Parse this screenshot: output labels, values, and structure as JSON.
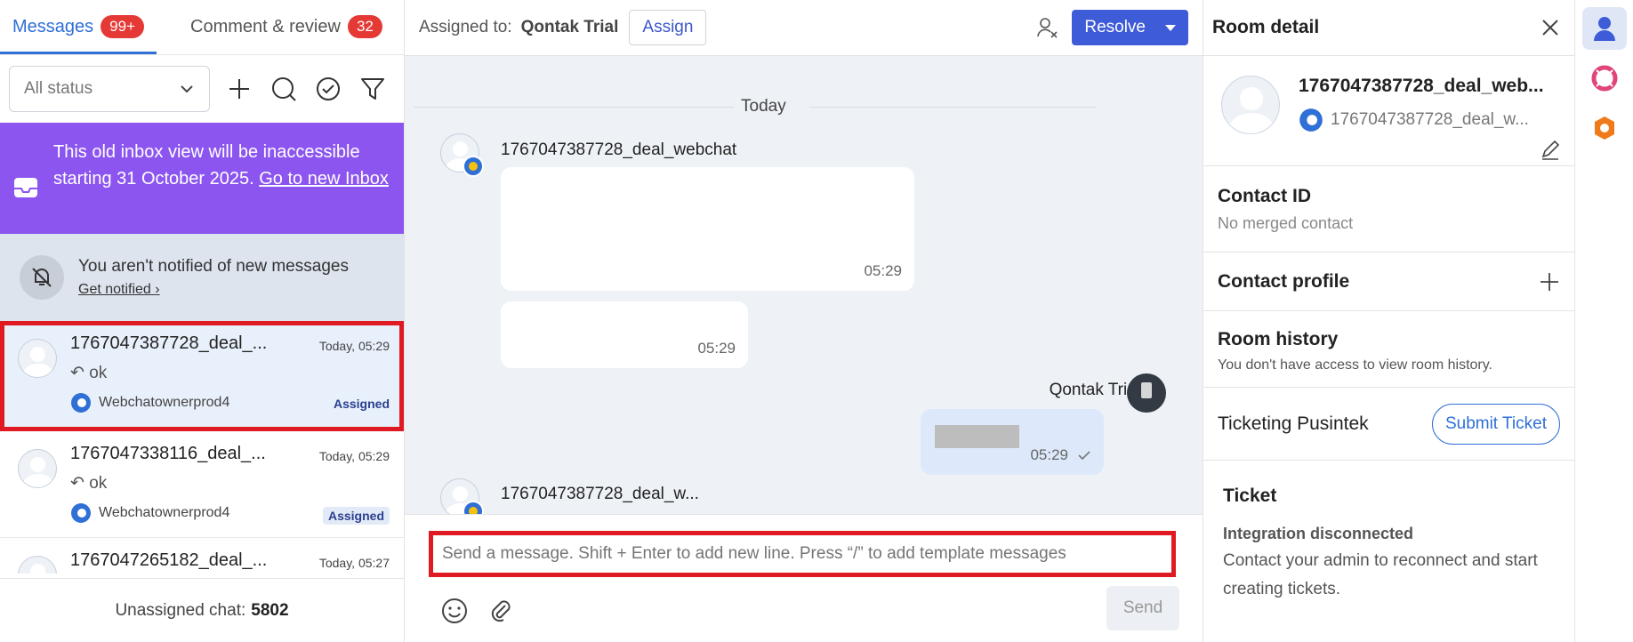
{
  "left": {
    "tabs": [
      {
        "label": "Messages",
        "badge": "99+"
      },
      {
        "label": "Comment & review",
        "badge": "32"
      }
    ],
    "status_filter": "All status",
    "banner": {
      "text": "This old inbox view will be inaccessible starting 31 October 2025. ",
      "link": "Go to new Inbox"
    },
    "notify": {
      "title": "You aren't notified of new messages",
      "link": "Get notified"
    },
    "chats": [
      {
        "name": "1767047387728_deal_...",
        "time": "Today, 05:29",
        "preview": "ok",
        "channel": "Webchatownerprod4",
        "status": "Assigned"
      },
      {
        "name": "1767047338116_deal_...",
        "time": "Today, 05:29",
        "preview": "ok",
        "channel": "Webchatownerprod4",
        "status": "Assigned"
      },
      {
        "name": "1767047265182_deal_...",
        "time": "Today, 05:27"
      }
    ],
    "unassigned_label": "Unassigned chat:",
    "unassigned_count": "5802"
  },
  "center": {
    "assigned_label": "Assigned to:",
    "assigned_to": "Qontak Trial",
    "assign_button": "Assign",
    "resolve_button": "Resolve",
    "date_divider": "Today",
    "messages": [
      {
        "sender": "1767047387728_deal_webchat",
        "time": "05:29"
      },
      {
        "time": "05:29"
      },
      {
        "sender": "Qontak Trial",
        "time": "05:29"
      },
      {
        "sender": "1767047387728_deal_w..."
      }
    ],
    "composer_placeholder": "Send a message. Shift + Enter to add new line. Press “/” to add template messages",
    "send_button": "Send"
  },
  "right": {
    "title": "Room detail",
    "room_name": "1767047387728_deal_web...",
    "room_sub": "1767047387728_deal_w...",
    "contact_id_title": "Contact ID",
    "contact_id_value": "No merged contact",
    "contact_profile_title": "Contact profile",
    "room_history_title": "Room history",
    "room_history_value": "You don't have access to view room history.",
    "ticketing_label": "Ticketing Pusintek",
    "submit_ticket": "Submit Ticket",
    "ticket_title": "Ticket",
    "ticket_warning": "Integration disconnected",
    "ticket_desc": "Contact your admin to reconnect and start creating tickets."
  },
  "colors": {
    "accent": "#3e5bd8",
    "badge": "#e53935",
    "banner": "#8c55f0",
    "highlight": "#e01a22"
  }
}
